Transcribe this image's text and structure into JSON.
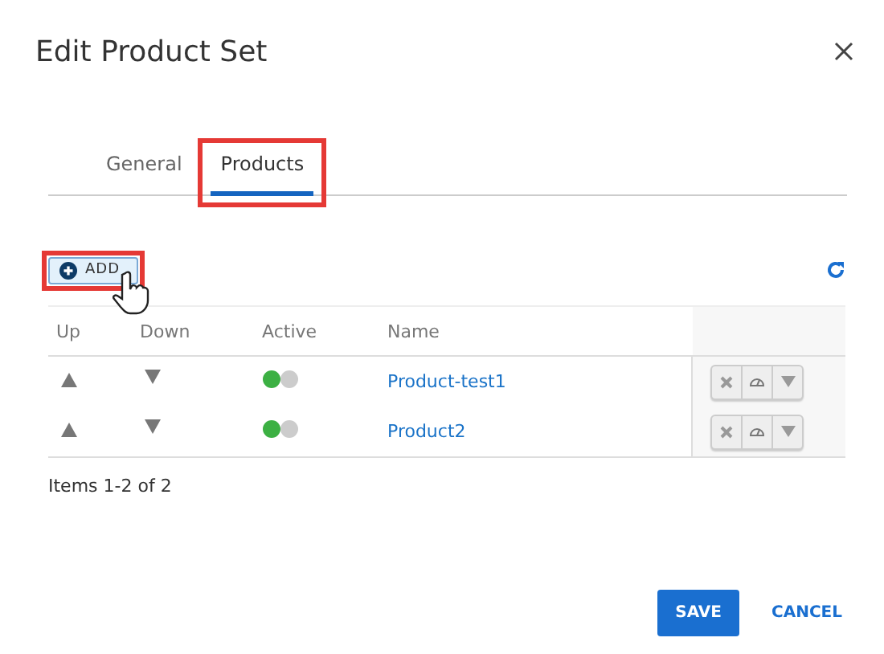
{
  "dialog": {
    "title": "Edit Product Set"
  },
  "tabs": [
    {
      "label": "General",
      "selected": false,
      "highlighted": false
    },
    {
      "label": "Products",
      "selected": true,
      "highlighted": true
    }
  ],
  "toolbar": {
    "add_button": {
      "label": "ADD",
      "highlighted": true
    }
  },
  "table": {
    "columns": [
      "Up",
      "Down",
      "Active",
      "Name"
    ],
    "rows": [
      {
        "name": "Product-test1",
        "active": true
      },
      {
        "name": "Product2",
        "active": true
      }
    ]
  },
  "pager": "Items 1-2 of 2",
  "buttons": {
    "save": "SAVE",
    "cancel": "CANCEL"
  }
}
